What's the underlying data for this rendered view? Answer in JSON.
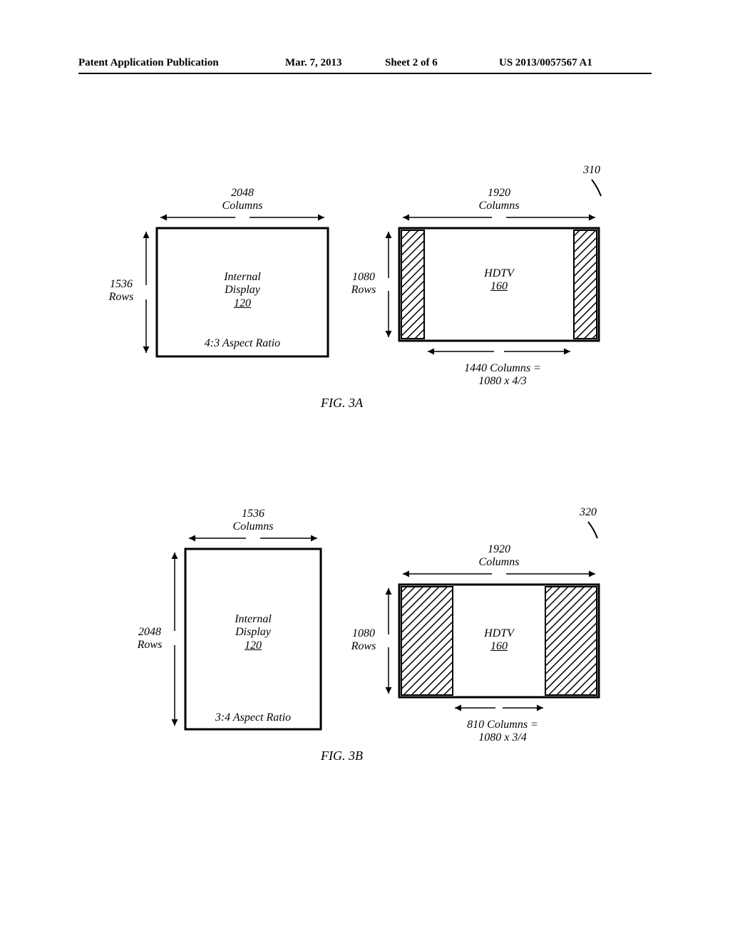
{
  "header": {
    "publication": "Patent Application Publication",
    "date": "Mar. 7, 2013",
    "sheet": "Sheet 2 of 6",
    "number": "US 2013/0057567 A1"
  },
  "fig3a": {
    "caption": "FIG. 3A",
    "ref": "310",
    "left": {
      "cols": "2048",
      "cols_label": "Columns",
      "rows": "1536",
      "rows_label": "Rows",
      "title": "Internal",
      "title2": "Display",
      "num": "120",
      "aspect": "4:3 Aspect Ratio"
    },
    "right": {
      "cols": "1920",
      "cols_label": "Columns",
      "rows": "1080",
      "rows_label": "Rows",
      "title": "HDTV",
      "num": "160",
      "inner_cols": "1440 Columns =",
      "inner_calc": "1080 x 4/3"
    }
  },
  "fig3b": {
    "caption": "FIG. 3B",
    "ref": "320",
    "left": {
      "cols": "1536",
      "cols_label": "Columns",
      "rows": "2048",
      "rows_label": "Rows",
      "title": "Internal",
      "title2": "Display",
      "num": "120",
      "aspect": "3:4 Aspect Ratio"
    },
    "right": {
      "cols": "1920",
      "cols_label": "Columns",
      "rows": "1080",
      "rows_label": "Rows",
      "title": "HDTV",
      "num": "160",
      "inner_cols": "810 Columns =",
      "inner_calc": "1080 x 3/4"
    }
  }
}
